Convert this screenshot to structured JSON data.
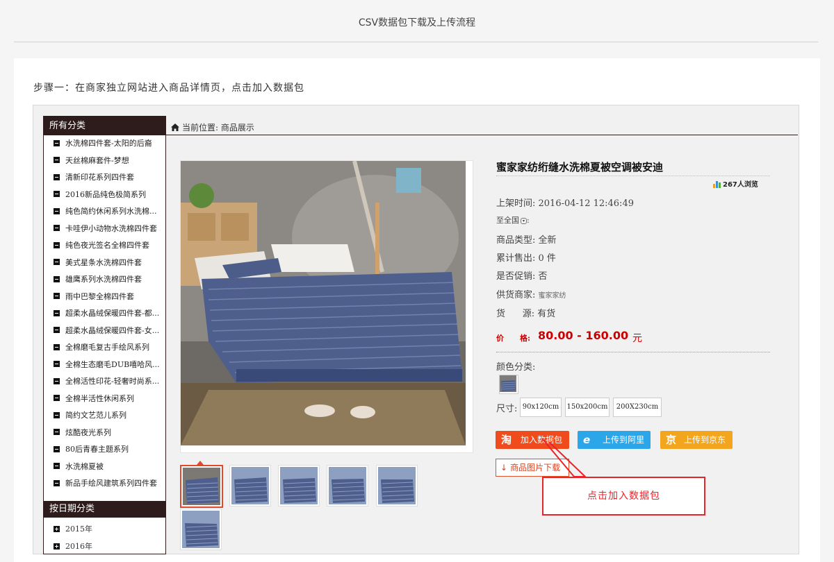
{
  "page": {
    "title": "CSV数据包下载及上传流程"
  },
  "step": {
    "text": "步骤一：在商家独立网站进入商品详情页，点击加入数据包"
  },
  "sidebar": {
    "header": "所有分类",
    "categories": [
      "水洗棉四件套-太阳的后裔",
      "天丝棉麻套件-梦想",
      "清新印花系列四件套",
      "2016新品纯色极简系列",
      "纯色简约休闲系列水洗棉...",
      "卡哇伊小动物水洗棉四件套",
      "纯色夜光签名全棉四件套",
      "美式星条水洗棉四件套",
      "雄鹰系列水洗棉四件套",
      "雨中巴黎全棉四件套",
      "超柔水晶绒保暖四件套-都...",
      "超柔水晶绒保暖四件套-女...",
      "全棉磨毛复古手绘风系列",
      "全棉生态磨毛DUB嘻哈风...",
      "全棉活性印花-轻奢时尚系...",
      "全棉半活性休闲系列",
      "简约文艺范儿系列",
      "炫酷夜光系列",
      "80后青春主题系列",
      "水洗棉夏被",
      "新品手绘风建筑系列四件套"
    ],
    "date_header": "按日期分类",
    "dates": [
      "2015年",
      "2016年"
    ]
  },
  "breadcrumb": {
    "icon": "home-icon",
    "text": "当前位置: 商品展示"
  },
  "product": {
    "title": "蜜家家纺绗缝水洗棉夏被空调被安迪",
    "views": "267人浏览",
    "listed": "上架时间:  2016-04-12 12:46:49",
    "ship_to": "至全国",
    "type": "商品类型:  全新",
    "sold": "累计售出:  0 件",
    "promo": "是否促销:  否",
    "supplier_label": "供货商家:",
    "supplier": "蜜家家纺",
    "stock": "货      源: 有货",
    "price_label": "价      格:",
    "price": "80.00 - 160.00",
    "price_unit": "元",
    "color_label": "颜色分类:",
    "size_label": "尺寸:",
    "sizes": [
      "90x120cm",
      "150x200cm",
      "200X230cm"
    ]
  },
  "buttons": {
    "taobao": "加入数据包",
    "taobao_icon": "淘",
    "ali": "上传到阿里",
    "ali_icon": "e",
    "jd": "上传到京东",
    "jd_icon": "京",
    "image_download": "商品图片下载"
  },
  "callout": {
    "text": "点击加入数据包"
  },
  "colors": {
    "accent_red": "#e8232b",
    "taobao": "#f04b1c",
    "ali": "#2ba6e8",
    "jd": "#f2a51d",
    "sidebar_dark": "#2d1c1b"
  }
}
